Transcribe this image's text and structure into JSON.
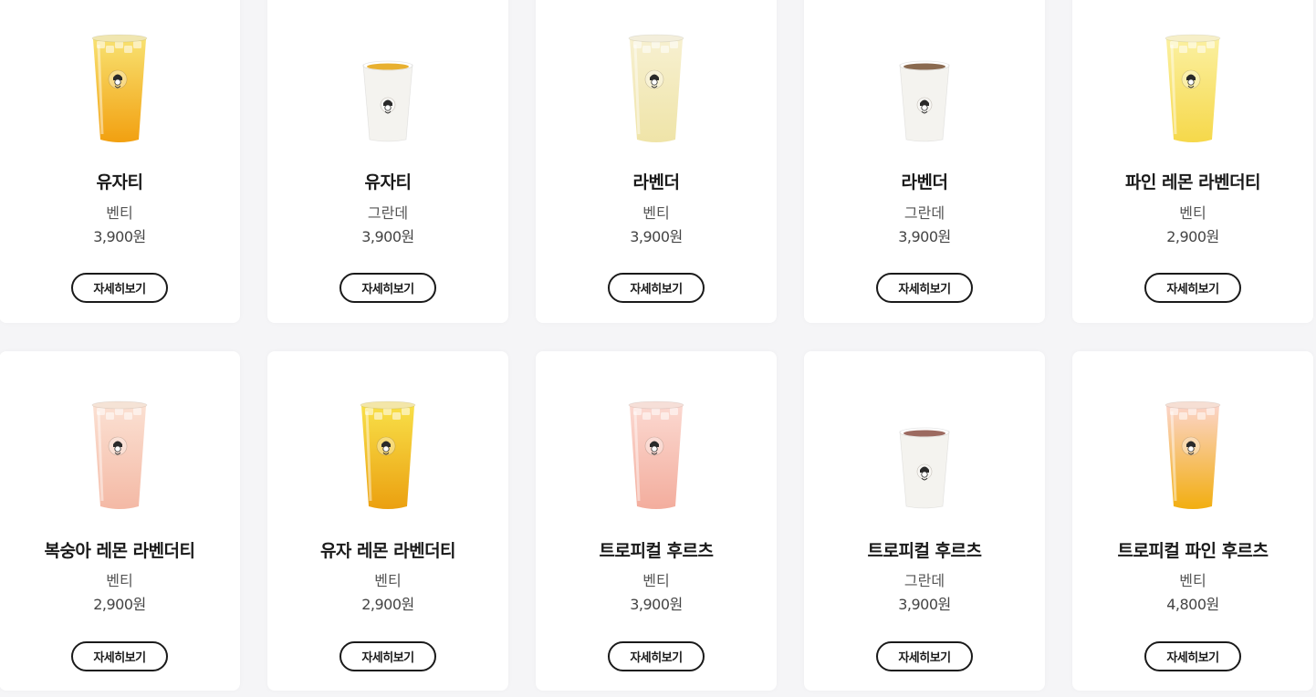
{
  "products": [
    {
      "name": "유자티",
      "size": "벤티",
      "price": "3,900원",
      "button_label": "자세히보기",
      "cup": {
        "kind": "iced",
        "top": "#f8e170",
        "bottom": "#f2a010",
        "lid": "#f0e6b0"
      }
    },
    {
      "name": "유자티",
      "size": "그란데",
      "price": "3,900원",
      "button_label": "자세히보기",
      "cup": {
        "kind": "paper",
        "drink": "#e8b030"
      }
    },
    {
      "name": "라벤더",
      "size": "벤티",
      "price": "3,900원",
      "button_label": "자세히보기",
      "cup": {
        "kind": "iced",
        "top": "#f7f0d0",
        "bottom": "#efe4a8",
        "lid": "#f3eedb"
      }
    },
    {
      "name": "라벤더",
      "size": "그란데",
      "price": "3,900원",
      "button_label": "자세히보기",
      "cup": {
        "kind": "paper",
        "drink": "#8a6a50"
      }
    },
    {
      "name": "파인 레몬 라벤더티",
      "size": "벤티",
      "price": "2,900원",
      "button_label": "자세히보기",
      "cup": {
        "kind": "iced",
        "top": "#fbf0a0",
        "bottom": "#f6d84a",
        "lid": "#f6efc8"
      }
    },
    {
      "name": "복숭아 레몬 라벤더티",
      "size": "벤티",
      "price": "2,900원",
      "button_label": "자세히보기",
      "cup": {
        "kind": "iced",
        "top": "#fbe0d2",
        "bottom": "#f4b9a5",
        "lid": "#f5e3d6"
      }
    },
    {
      "name": "유자 레몬 라벤더티",
      "size": "벤티",
      "price": "2,900원",
      "button_label": "자세히보기",
      "cup": {
        "kind": "iced",
        "top": "#f8df48",
        "bottom": "#eba010",
        "lid": "#f3e6a8"
      }
    },
    {
      "name": "트로피컬 후르츠",
      "size": "벤티",
      "price": "3,900원",
      "button_label": "자세히보기",
      "cup": {
        "kind": "iced",
        "top": "#fbd8d0",
        "bottom": "#f3ad9d",
        "lid": "#f6dfd8"
      }
    },
    {
      "name": "트로피컬 후르츠",
      "size": "그란데",
      "price": "3,900원",
      "button_label": "자세히보기",
      "cup": {
        "kind": "paper",
        "drink": "#9c6a60"
      }
    },
    {
      "name": "트로피컬 파인 후르츠",
      "size": "벤티",
      "price": "4,800원",
      "button_label": "자세히보기",
      "cup": {
        "kind": "iced",
        "top": "#fbd4c8",
        "bottom": "#f2ae10",
        "lid": "#f6dfd4"
      }
    }
  ]
}
